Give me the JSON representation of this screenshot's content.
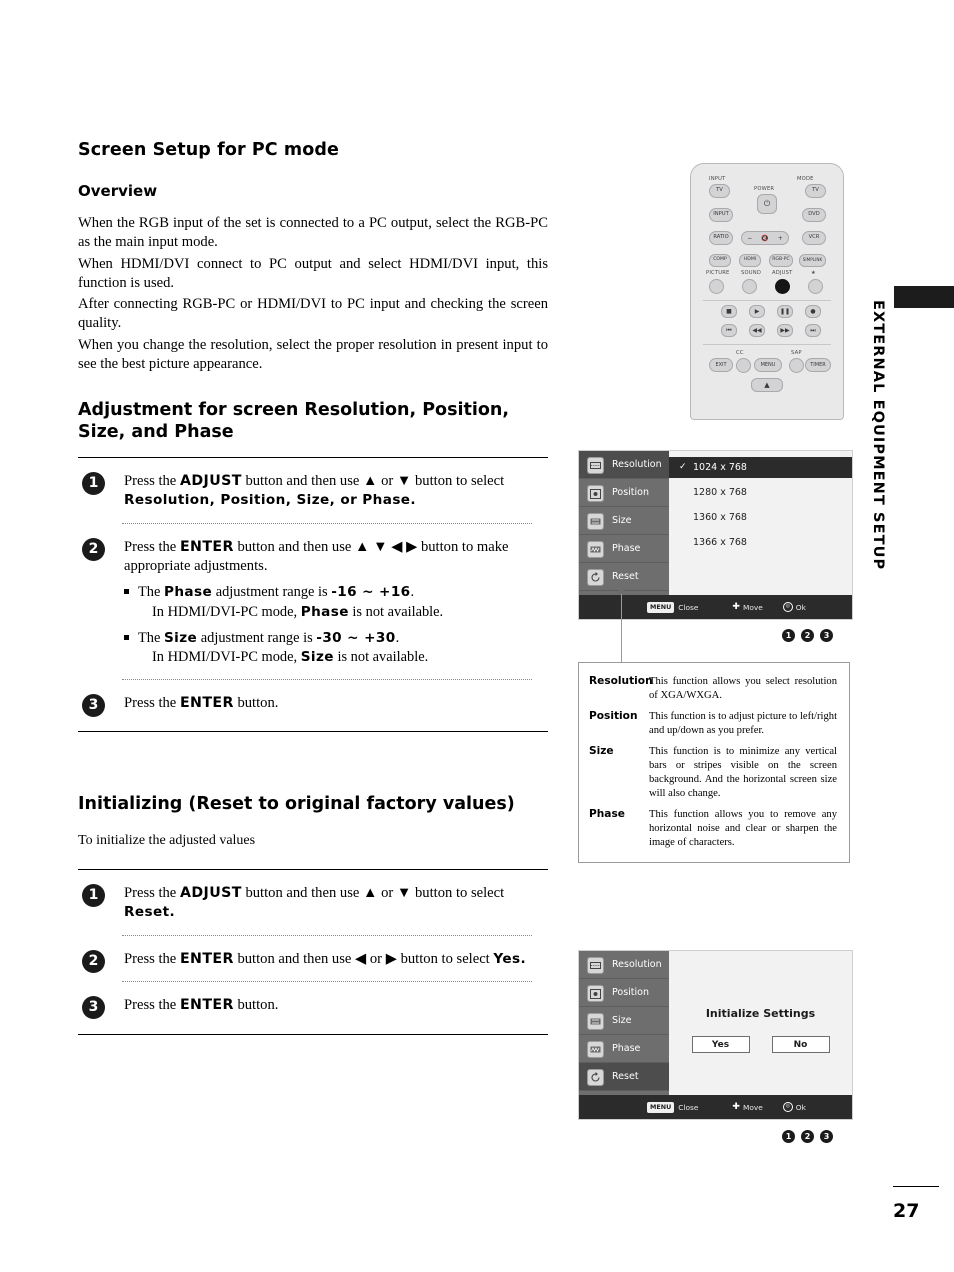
{
  "page": {
    "number": "27",
    "side_label": "EXTERNAL EQUIPMENT SETUP"
  },
  "left": {
    "title": "Screen Setup for PC mode",
    "overview_heading": "Overview",
    "overview_paras": [
      "When the RGB input of the set is connected to a PC output, select the RGB-PC as the main input mode.",
      "When HDMI/DVI connect to PC output and select HDMI/DVI input, this function is used.",
      "After connecting RGB-PC or HDMI/DVI to PC input and checking the screen quality.",
      "When you change the resolution, select the proper resolution in present input to see the best picture appearance."
    ],
    "adjust_heading": "Adjustment for screen Resolution, Position, Size, and Phase",
    "steps": [
      {
        "num": "1",
        "pre": "Press the ",
        "kw1": "ADJUST",
        "mid": " button and then use ",
        "arrows": "▲ or ▼",
        "post": " button to select ",
        "opts": "Resolution, Position, Size, or Phase."
      },
      {
        "num": "2",
        "pre": "Press the ",
        "kw1": "ENTER",
        "mid": " button and then use ",
        "arrows": "▲ ▼ ◀ ▶",
        "post": " button to make appropriate adjustments.",
        "bullets": [
          {
            "a": "The ",
            "kw": "Phase",
            "b": " adjustment range is ",
            "range": "-16 ~ +16",
            "c": ".",
            "sub_a": "In HDMI/DVI-PC mode, ",
            "sub_kw": "Phase",
            "sub_b": " is not available."
          },
          {
            "a": "The ",
            "kw": "Size",
            "b": " adjustment range is ",
            "range": "-30 ~ +30",
            "c": ".",
            "sub_a": "In HDMI/DVI-PC mode, ",
            "sub_kw": "Size",
            "sub_b": " is not available."
          }
        ]
      },
      {
        "num": "3",
        "pre": "Press the ",
        "kw1": "ENTER",
        "mid": " button.",
        "arrows": "",
        "post": "",
        "opts": ""
      }
    ],
    "init_heading": "Initializing (Reset to original factory values)",
    "init_sub": "To initialize the adjusted values",
    "init_steps": [
      {
        "num": "1",
        "pre": "Press the ",
        "kw1": "ADJUST",
        "mid": " button and then use ",
        "arrows": "▲ or ▼",
        "post": " button to select ",
        "opts": "Reset."
      },
      {
        "num": "2",
        "pre": "Press the ",
        "kw1": "ENTER",
        "mid": " button and then use ",
        "arrows": "◀ or ▶",
        "post": " button to select ",
        "opts": "Yes."
      },
      {
        "num": "3",
        "pre": "Press the ",
        "kw1": "ENTER",
        "mid": " button.",
        "arrows": "",
        "post": "",
        "opts": ""
      }
    ]
  },
  "remote": {
    "labels": {
      "input": "INPUT",
      "mode": "MODE",
      "power": "POWER",
      "tv_left": "TV",
      "tv_right": "TV",
      "input_btn": "INPUT",
      "dvd": "DVD",
      "ratio": "RATIO",
      "vcr": "VCR",
      "comp": "COMP",
      "hdmi": "HDMI",
      "rgbpc": "RGB-PC",
      "simplink": "SIMPLINK",
      "picture": "PICTURE",
      "sound": "SOUND",
      "adjust": "ADJUST",
      "fav": "★",
      "cc": "CC",
      "sap": "SAP",
      "exit": "EXIT",
      "menu": "MENU",
      "timer": "TIMER",
      "vol_minus": "−",
      "vol_plus": "+",
      "mute": "🔇"
    }
  },
  "osd1": {
    "items": [
      {
        "label": "Resolution",
        "icon": "resolution-icon",
        "selected": true
      },
      {
        "label": "Position",
        "icon": "position-icon",
        "selected": false
      },
      {
        "label": "Size",
        "icon": "size-icon",
        "selected": false
      },
      {
        "label": "Phase",
        "icon": "phase-icon",
        "selected": false
      },
      {
        "label": "Reset",
        "icon": "reset-icon",
        "selected": false
      }
    ],
    "resolutions": [
      {
        "label": "1024 x 768",
        "checked": true,
        "highlight": true
      },
      {
        "label": "1280 x 768",
        "checked": false,
        "highlight": false
      },
      {
        "label": "1360 x 768",
        "checked": false,
        "highlight": false
      },
      {
        "label": "1366 x 768",
        "checked": false,
        "highlight": false
      }
    ],
    "footer": {
      "menu": "MENU",
      "close": "Close",
      "move": "Move",
      "ok": "Ok"
    },
    "pager": [
      "1",
      "2",
      "3"
    ]
  },
  "desc": [
    {
      "term": "Resolution",
      "text": "This function allows you select resolution of XGA/WXGA."
    },
    {
      "term": "Position",
      "text": "This function is to adjust picture to left/right and up/down as you prefer."
    },
    {
      "term": "Size",
      "text": "This function is to minimize any vertical bars or stripes visible on the screen background. And the horizontal screen size will also change."
    },
    {
      "term": "Phase",
      "text": "This function allows you to remove any horizontal noise and clear or sharpen the image of characters."
    }
  ],
  "osd2": {
    "items": [
      {
        "label": "Resolution",
        "icon": "resolution-icon",
        "selected": false
      },
      {
        "label": "Position",
        "icon": "position-icon",
        "selected": false
      },
      {
        "label": "Size",
        "icon": "size-icon",
        "selected": false
      },
      {
        "label": "Phase",
        "icon": "phase-icon",
        "selected": false
      },
      {
        "label": "Reset",
        "icon": "reset-icon",
        "selected": true
      }
    ],
    "dialog_title": "Initialize Settings",
    "yes": "Yes",
    "no": "No",
    "footer": {
      "menu": "MENU",
      "close": "Close",
      "move": "Move",
      "ok": "Ok"
    },
    "pager": [
      "1",
      "2",
      "3"
    ]
  }
}
